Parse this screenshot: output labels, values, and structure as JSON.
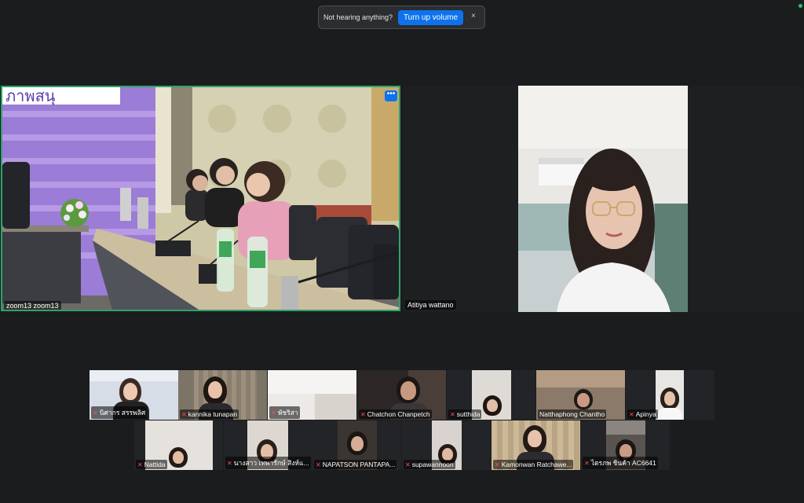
{
  "notification": {
    "text": "Not hearing anything?",
    "button_label": "Turn up volume",
    "close_glyph": "×"
  },
  "main_tiles": [
    {
      "name": "zoom13 zoom13",
      "speaking": true,
      "menu_glyph": "•••"
    },
    {
      "name": "Atitiya wattano"
    }
  ],
  "gallery_row1": [
    {
      "name": "นิศากร  สรรพลิศ",
      "muted": true
    },
    {
      "name": "kannika tunapan",
      "muted": true
    },
    {
      "name": "พัชริสา",
      "muted": true
    },
    {
      "name": "Chatchon Chanpetch",
      "muted": true
    },
    {
      "name": "sutthida",
      "muted": true
    },
    {
      "name": "Natthaphong Chantho",
      "muted": false
    },
    {
      "name": "Apinya",
      "muted": true
    }
  ],
  "gallery_row2": [
    {
      "name": "Nattida",
      "muted": true
    },
    {
      "name": "นางสาว เทพารักษ์ สิงห์แ...",
      "muted": true
    },
    {
      "name": "NAPATSON PANTAPA...",
      "muted": true
    },
    {
      "name": "supawannoon",
      "muted": true
    },
    {
      "name": "Kamonwan Ratchawe...",
      "muted": true
    },
    {
      "name": "ไตรภพ ชินค้า AC6641",
      "muted": true
    }
  ],
  "icons": {
    "mic_muted": "mic-off-icon",
    "more": "more-options-icon",
    "close": "close-icon"
  },
  "colors": {
    "accent": "#0e72ed",
    "speaking_border": "#2fa36b",
    "muted": "#ff4d4d",
    "background": "#1b1c1e"
  }
}
